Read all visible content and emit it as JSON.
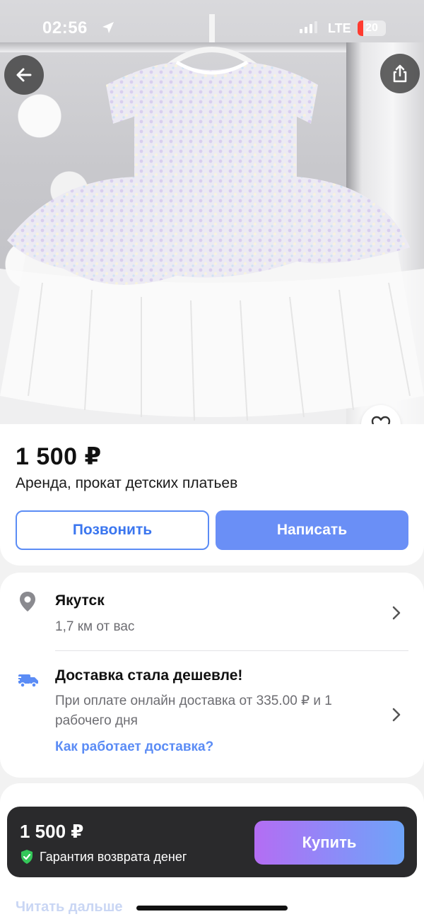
{
  "status_bar": {
    "time": "02:56",
    "network": "LTE",
    "battery": "20"
  },
  "listing": {
    "price": "1 500 ₽",
    "title": "Аренда, прокат детских платьев",
    "call_label": "Позвонить",
    "write_label": "Написать"
  },
  "location": {
    "city": "Якутск",
    "distance": "1,7 км от вас"
  },
  "delivery": {
    "title": "Доставка стала дешевле!",
    "text": "При оплате онлайн доставка от 335.00 ₽ и 1 рабочего дня",
    "link": "Как работает доставка?"
  },
  "buy_bar": {
    "price": "1 500 ₽",
    "guarantee": "Гарантия возврата денег",
    "buy_label": "Купить"
  },
  "read_more": "Читать дальше",
  "icons": [
    "back-arrow-icon",
    "share-icon",
    "heart-icon",
    "location-pin-icon",
    "truck-icon",
    "chevron-right-icon",
    "shield-check-icon",
    "location-arrow-icon"
  ],
  "colors": {
    "accent": "#6a8ff6",
    "link": "#5b8cf5",
    "buybar": "#2a2a2c",
    "shield": "#34c759"
  }
}
